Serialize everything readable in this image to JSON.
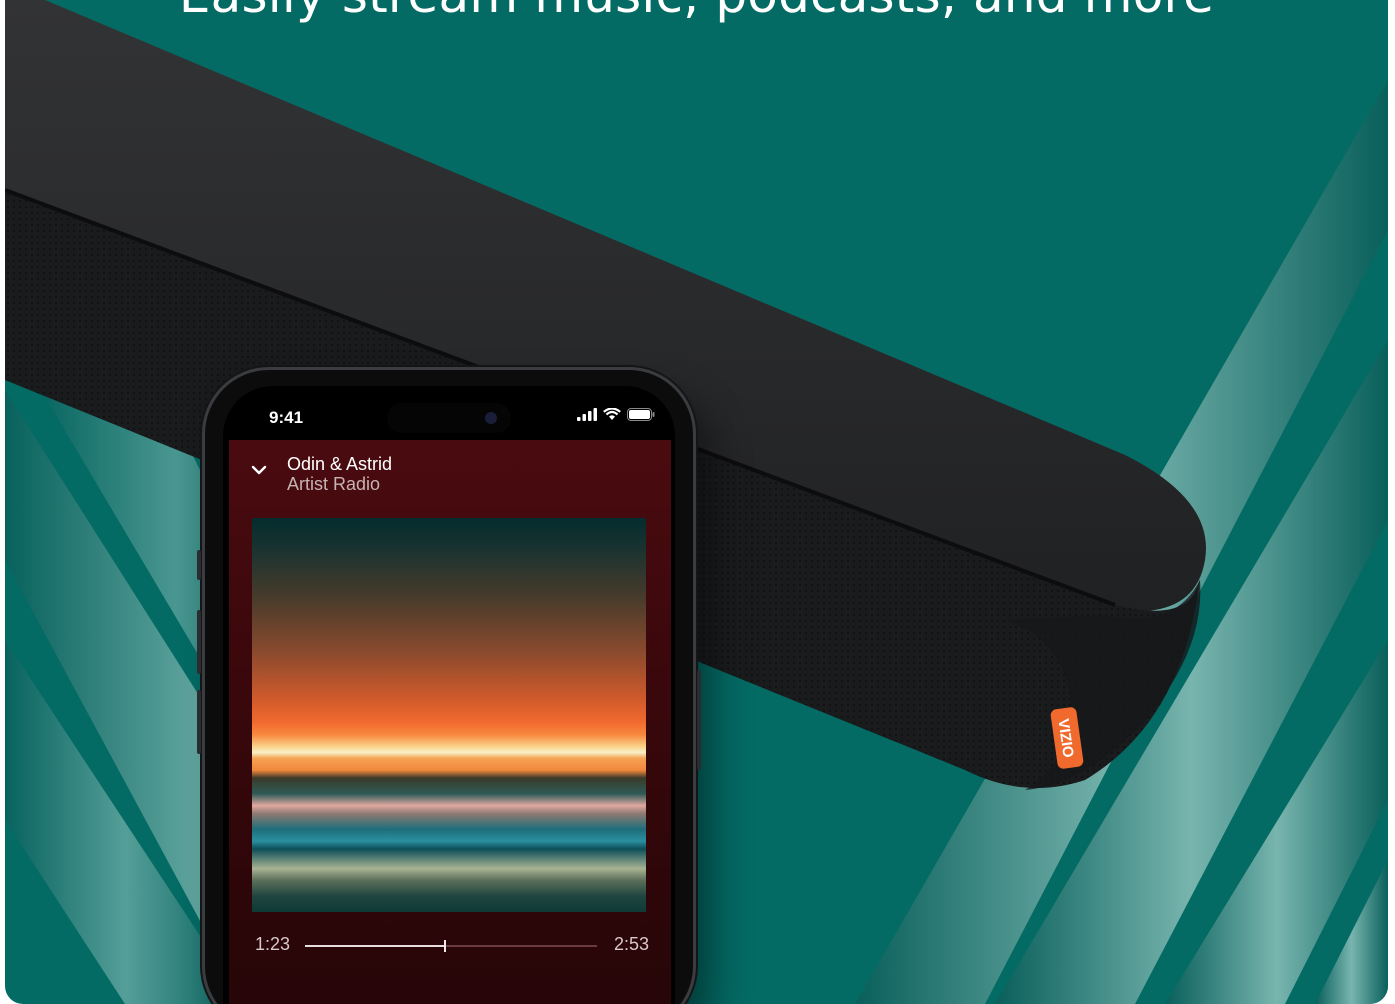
{
  "headline": "Easily stream music, podcasts, and more",
  "brand_logo": "VIZIO",
  "colors": {
    "background_teal": "#046a64",
    "soundbar_black": "#1e1f21",
    "logo_orange": "#ef6a2c",
    "player_maroon": "#4a0b10"
  },
  "phone": {
    "status": {
      "time": "9:41",
      "icons": [
        "cellular-signal-icon",
        "wifi-icon",
        "battery-icon"
      ]
    },
    "player": {
      "collapse_icon": "chevron-down-icon",
      "title": "Odin & Astrid",
      "subtitle": "Artist Radio",
      "elapsed": "1:23",
      "duration": "2:53",
      "progress": 0.48
    }
  }
}
